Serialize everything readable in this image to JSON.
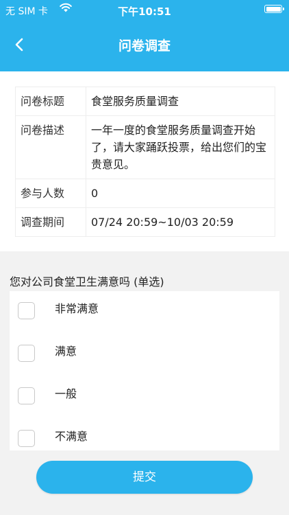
{
  "status_bar": {
    "carrier": "无 SIM 卡",
    "time": "下午10:51"
  },
  "nav": {
    "title": "问卷调查"
  },
  "info": {
    "rows": [
      {
        "key": "问卷标题",
        "value": "食堂服务质量调查"
      },
      {
        "key": "问卷描述",
        "value": "一年一度的食堂服务质量调查开始了，请大家踊跃投票，给出您们的宝贵意见。"
      },
      {
        "key": "参与人数",
        "value": "0"
      },
      {
        "key": "调查期间",
        "value": "07/24 20:59~10/03 20:59"
      }
    ]
  },
  "question": {
    "text": "您对公司食堂卫生满意吗 (单选)",
    "options": [
      {
        "label": "非常满意",
        "checked": false
      },
      {
        "label": "满意",
        "checked": false
      },
      {
        "label": "一般",
        "checked": false
      },
      {
        "label": "不满意",
        "checked": false
      }
    ]
  },
  "submit_label": "提交",
  "colors": {
    "accent": "#2bb3ec",
    "background": "#f2f2f2"
  }
}
